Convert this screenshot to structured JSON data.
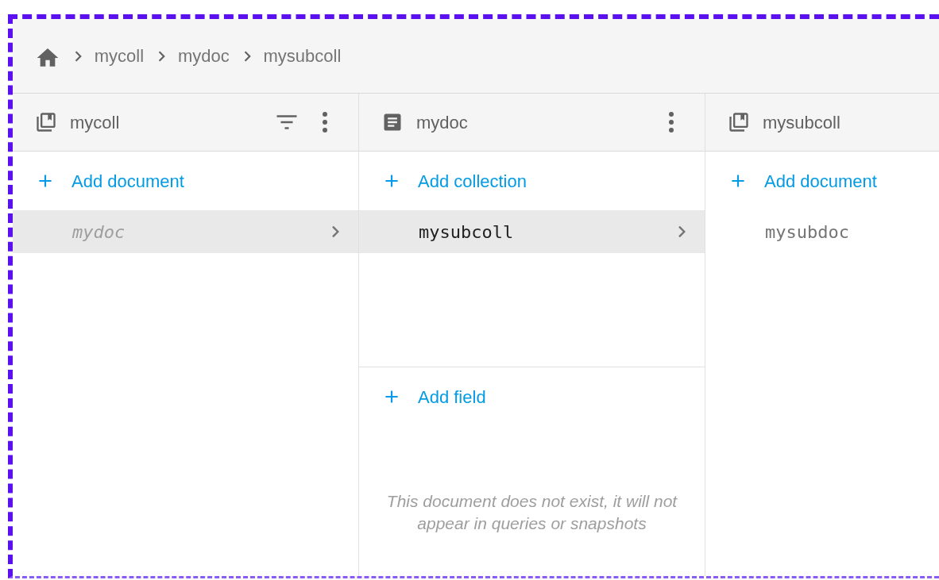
{
  "breadcrumbs": [
    "mycoll",
    "mydoc",
    "mysubcoll"
  ],
  "columns": [
    {
      "kind": "collection",
      "title": "mycoll",
      "filter_button": true,
      "menu_button": true,
      "add_label": "Add document",
      "items": [
        {
          "label": "mydoc",
          "selected": true,
          "missing": true
        }
      ]
    },
    {
      "kind": "document",
      "title": "mydoc",
      "filter_button": false,
      "menu_button": true,
      "add_label": "Add collection",
      "items": [
        {
          "label": "mysubcoll",
          "selected": true,
          "missing": false
        }
      ],
      "fields": {
        "add_label": "Add field",
        "notice": "This document does not exist, it will not appear in queries or snapshots"
      }
    },
    {
      "kind": "collection",
      "title": "mysubcoll",
      "filter_button": false,
      "menu_button": false,
      "add_label": "Add document",
      "items": [
        {
          "label": "mysubdoc",
          "selected": false,
          "missing": false
        }
      ]
    }
  ]
}
